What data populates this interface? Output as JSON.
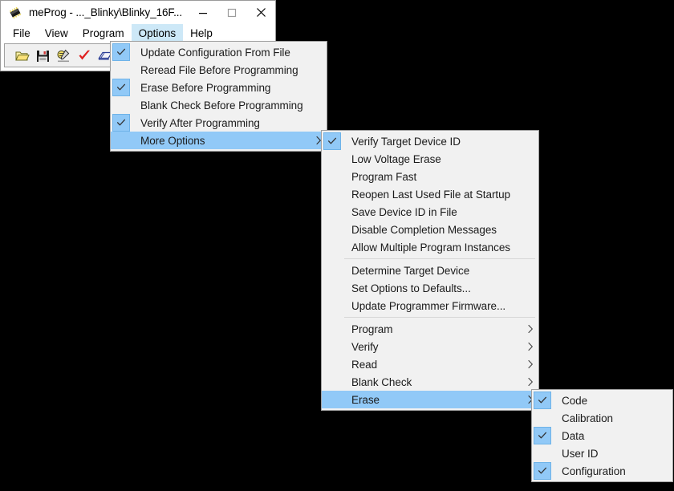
{
  "window": {
    "title": "meProg - ..._Blinky\\Blinky_16F...",
    "icon": "chip-icon",
    "buttons": {
      "minimize": "minimize-icon",
      "maximize": "maximize-icon",
      "close": "close-icon"
    }
  },
  "menubar": {
    "items": [
      {
        "label": "File",
        "active": false
      },
      {
        "label": "View",
        "active": false
      },
      {
        "label": "Program",
        "active": false
      },
      {
        "label": "Options",
        "active": true
      },
      {
        "label": "Help",
        "active": false
      }
    ]
  },
  "toolbar": {
    "buttons": [
      {
        "name": "open-file-icon",
        "title": "Open"
      },
      {
        "name": "save-file-icon",
        "title": "Save"
      },
      {
        "name": "program-device-icon",
        "title": "Program"
      },
      {
        "name": "verify-check-icon",
        "title": "Verify"
      },
      {
        "name": "read-book-icon",
        "title": "Read"
      },
      {
        "name": "blank-check-bulb-icon",
        "title": "Blank Check"
      }
    ]
  },
  "colors": {
    "accent_selected": "#91c9f7",
    "menubar_active": "#cde8f7",
    "menu_background": "#f1f1f1",
    "window_background": "#ffffff",
    "toolbar_background": "#f0f0f0",
    "border": "#a0a0a0",
    "separator": "#d7d7d7",
    "text": "#1b1b1b"
  },
  "menus": {
    "options": {
      "name": "options-menu",
      "items": [
        {
          "label": "Update Configuration From File",
          "checked": true,
          "submenu": false,
          "selected": false,
          "separator_before": false
        },
        {
          "label": "Reread File Before Programming",
          "checked": false,
          "submenu": false,
          "selected": false,
          "separator_before": false
        },
        {
          "label": "Erase Before Programming",
          "checked": true,
          "submenu": false,
          "selected": false,
          "separator_before": false
        },
        {
          "label": "Blank Check Before Programming",
          "checked": false,
          "submenu": false,
          "selected": false,
          "separator_before": false
        },
        {
          "label": "Verify After Programming",
          "checked": true,
          "submenu": false,
          "selected": false,
          "separator_before": false
        },
        {
          "label": "More Options",
          "checked": false,
          "submenu": true,
          "selected": true,
          "separator_before": false
        }
      ]
    },
    "more_options": {
      "name": "more-options-submenu",
      "items": [
        {
          "label": "Verify Target Device ID",
          "checked": true,
          "submenu": false,
          "selected": false,
          "separator_before": false
        },
        {
          "label": "Low Voltage Erase",
          "checked": false,
          "submenu": false,
          "selected": false,
          "separator_before": false
        },
        {
          "label": "Program Fast",
          "checked": false,
          "submenu": false,
          "selected": false,
          "separator_before": false
        },
        {
          "label": "Reopen Last Used File at Startup",
          "checked": false,
          "submenu": false,
          "selected": false,
          "separator_before": false
        },
        {
          "label": "Save Device ID in File",
          "checked": false,
          "submenu": false,
          "selected": false,
          "separator_before": false
        },
        {
          "label": "Disable Completion Messages",
          "checked": false,
          "submenu": false,
          "selected": false,
          "separator_before": false
        },
        {
          "label": "Allow Multiple Program Instances",
          "checked": false,
          "submenu": false,
          "selected": false,
          "separator_before": false
        },
        {
          "label": "Determine Target Device",
          "checked": false,
          "submenu": false,
          "selected": false,
          "separator_before": true
        },
        {
          "label": "Set Options to Defaults...",
          "checked": false,
          "submenu": false,
          "selected": false,
          "separator_before": false
        },
        {
          "label": "Update Programmer Firmware...",
          "checked": false,
          "submenu": false,
          "selected": false,
          "separator_before": false
        },
        {
          "label": "Program",
          "checked": false,
          "submenu": true,
          "selected": false,
          "separator_before": true
        },
        {
          "label": "Verify",
          "checked": false,
          "submenu": true,
          "selected": false,
          "separator_before": false
        },
        {
          "label": "Read",
          "checked": false,
          "submenu": true,
          "selected": false,
          "separator_before": false
        },
        {
          "label": "Blank Check",
          "checked": false,
          "submenu": true,
          "selected": false,
          "separator_before": false
        },
        {
          "label": "Erase",
          "checked": false,
          "submenu": true,
          "selected": true,
          "separator_before": false
        }
      ]
    },
    "erase": {
      "name": "erase-submenu",
      "items": [
        {
          "label": "Code",
          "checked": true,
          "submenu": false,
          "selected": false,
          "separator_before": false
        },
        {
          "label": "Calibration",
          "checked": false,
          "submenu": false,
          "selected": false,
          "separator_before": false
        },
        {
          "label": "Data",
          "checked": true,
          "submenu": false,
          "selected": false,
          "separator_before": false
        },
        {
          "label": "User ID",
          "checked": false,
          "submenu": false,
          "selected": false,
          "separator_before": false
        },
        {
          "label": "Configuration",
          "checked": true,
          "submenu": false,
          "selected": false,
          "separator_before": false
        }
      ]
    }
  }
}
